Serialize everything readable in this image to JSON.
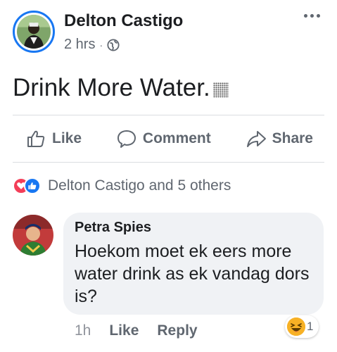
{
  "post": {
    "author": "Delton Castigo",
    "time": "2 hrs",
    "separator": "·",
    "privacy_icon": "globe-icon",
    "text": "Drink More Water.",
    "more_icon": "more-options-icon"
  },
  "actions": {
    "like": "Like",
    "comment": "Comment",
    "share": "Share"
  },
  "reactions": {
    "icons": [
      "love-reaction-icon",
      "like-reaction-icon"
    ],
    "summary": "Delton Castigo and 5 others"
  },
  "comment": {
    "author": "Petra Spies",
    "text": "Hoekom moet ek eers more water drink as ek vandag dors is?",
    "time": "1h",
    "like": "Like",
    "reply": "Reply",
    "reaction_icon": "haha-reaction-icon",
    "reaction_count": "1"
  },
  "colors": {
    "accent": "#1877f2",
    "love": "#f33e58",
    "haha": "#f7b125",
    "bubble": "#f0f2f5",
    "secondary_text": "#606770"
  }
}
